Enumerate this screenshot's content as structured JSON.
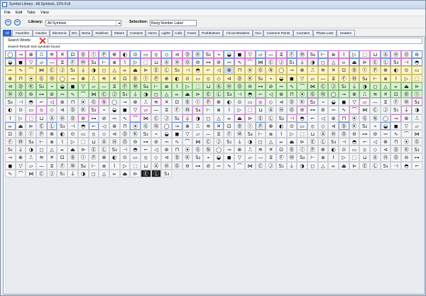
{
  "window": {
    "title": "Symbol Library - All Symbols, 32% Full"
  },
  "menu": [
    {
      "label": "File"
    },
    {
      "label": "Edit"
    },
    {
      "label": "Tabs"
    },
    {
      "label": "View"
    }
  ],
  "toolbar": {
    "library_label": "Library:",
    "library_value": "All Symbols",
    "selection_label": "Selection:",
    "selection_value": "Rung Number Label"
  },
  "tabs": [
    {
      "label": "All",
      "active": true
    },
    {
      "label": "Favorites",
      "active": false
    },
    {
      "label": "Inactive",
      "active": false
    },
    {
      "label": "Electronic",
      "active": false
    },
    {
      "label": "IEC",
      "active": false
    },
    {
      "label": "Nema",
      "active": false
    },
    {
      "label": "Switches",
      "active": false
    },
    {
      "label": "Motors",
      "active": false
    },
    {
      "label": "Contacts",
      "active": false
    },
    {
      "label": "Horns",
      "active": false
    },
    {
      "label": "Lights",
      "active": false
    },
    {
      "label": "Coils",
      "active": false
    },
    {
      "label": "Fuses",
      "active": false
    },
    {
      "label": "Pushbuttons",
      "active": false
    },
    {
      "label": "Circuit Breakers",
      "active": false
    },
    {
      "label": "OLs",
      "active": false
    },
    {
      "label": "Common Points",
      "active": false
    },
    {
      "label": "Counters",
      "active": false
    },
    {
      "label": "Phase Loss",
      "active": false
    },
    {
      "label": "Heaters",
      "active": false
    }
  ],
  "search": {
    "label": "Search Words:",
    "value": ""
  },
  "result": {
    "text": "Search Result: 616 symbols found"
  },
  "icons": [
    "app-icon",
    "search-icon",
    "close-icon",
    "chevron-down-icon",
    "zoom-in-icon",
    "zoom-out-icon"
  ],
  "grid": {
    "symbol_count": 616,
    "columns": 40,
    "glyphs": [
      "◯",
      "⊖",
      "⊕",
      "⏚",
      "⌁",
      "⊣",
      "⊢",
      "⊸",
      "⊶",
      "◐",
      "◑",
      "◒",
      "◓",
      "⧈",
      "⊗",
      "⊘",
      "⊙",
      "◻",
      "◼",
      "⌐",
      "⌇",
      "⎍",
      "⎓",
      "▭",
      "△",
      "▽",
      "◁",
      "▷",
      "≋",
      "∿",
      "⦸",
      "⦵",
      "⏥",
      "⊛",
      "⬚",
      "✕",
      "⌒",
      "◇",
      "⏏",
      "—",
      "⊓",
      "⊔",
      "⊡",
      "⋈",
      "⊲",
      "⊳",
      "⧖",
      "⦿",
      "Ⓐ",
      "Ⓑ",
      "Ⓒ",
      "Ⓓ",
      "Ⓔ",
      "Ⓕ",
      "Ⓖ",
      "Ⓗ",
      "Ⓘ",
      "Ⓙ",
      "Ⓚ",
      "Ⓛ",
      "Ⓜ",
      "Ⓝ",
      "Ⓞ",
      "Ⓟ",
      "S₁",
      "S₂",
      "S₃",
      "S₄"
    ]
  }
}
